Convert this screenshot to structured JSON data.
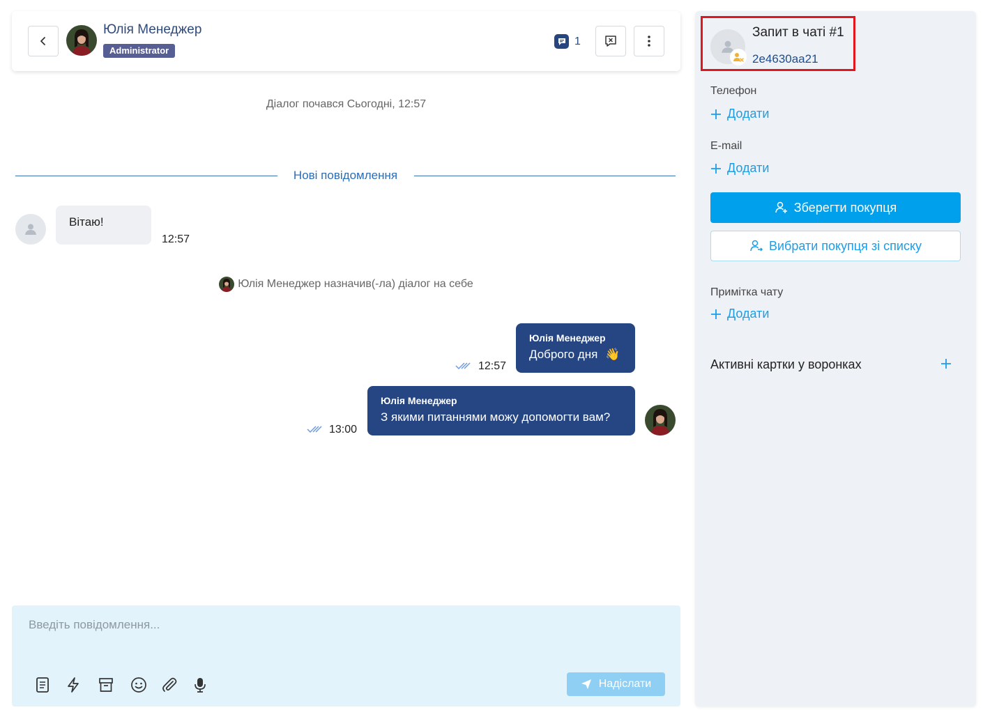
{
  "header": {
    "manager_name": "Юлія Менеджер",
    "role": "Administrator",
    "message_count": "1"
  },
  "chat": {
    "dialog_started": "Діалог почався Сьогодні, 12:57",
    "new_messages": "Нові повідомлення",
    "incoming": {
      "text": "Вітаю!",
      "time": "12:57"
    },
    "assign_notice": "Юлія Менеджер назначив(-ла) діалог на себе",
    "outgoing": [
      {
        "author": "Юлія Менеджер",
        "text": "Доброго дня",
        "emoji": "👋",
        "time": "12:57"
      },
      {
        "author": "Юлія Менеджер",
        "text": "З якими питаннями можу допомогти вам?",
        "time": "13:00"
      }
    ]
  },
  "composer": {
    "placeholder": "Введіть повідомлення...",
    "send_label": "Надіслати"
  },
  "panel": {
    "request_title": "Запит в чаті #1",
    "request_id": "2e4630aa21",
    "phone_label": "Телефон",
    "email_label": "E-mail",
    "add_label": "Додати",
    "save_customer": "Зберегти покупця",
    "choose_customer": "Вибрати покупця зі списку",
    "note_label": "Примітка чату",
    "funnels_title": "Активні картки у воронках"
  },
  "colors": {
    "primary_dark": "#264683",
    "accent_blue": "#00a0ec",
    "highlight_red": "#e3151c"
  }
}
